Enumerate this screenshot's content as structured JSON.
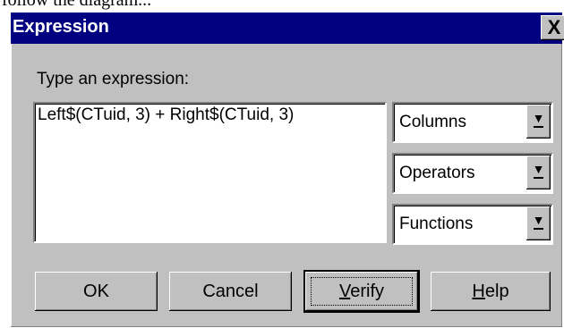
{
  "page": {
    "top_text": "follow the diagram..."
  },
  "dialog": {
    "title": "Expression",
    "close_glyph": "X",
    "prompt_label": "Type an expression:",
    "expression_value": "Left$(CTuid, 3) + Right$(CTuid, 3)"
  },
  "dropdowns": {
    "columns": {
      "value": "Columns"
    },
    "operators": {
      "value": "Operators"
    },
    "functions": {
      "value": "Functions"
    },
    "arrow_glyph": "▼"
  },
  "buttons": {
    "ok_label": "OK",
    "cancel_label": "Cancel",
    "verify": {
      "mnemonic": "V",
      "rest": "erify"
    },
    "help": {
      "mnemonic": "H",
      "rest": "elp"
    }
  },
  "colors": {
    "dialog_face": "#c0c0c0",
    "title_bar": "#000080",
    "title_text": "#ffffff"
  }
}
